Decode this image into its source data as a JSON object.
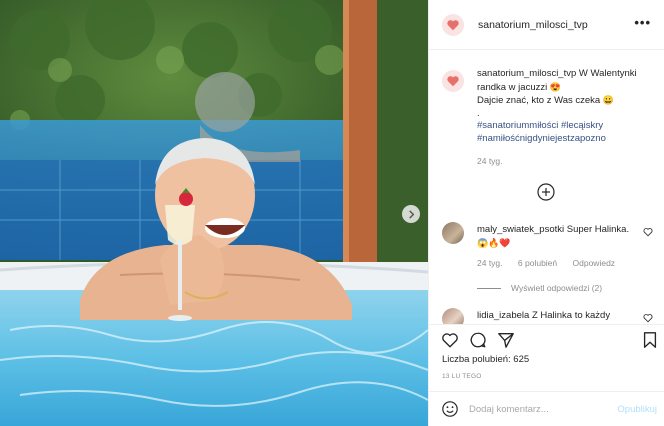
{
  "post": {
    "username": "sanatorium_milosci_tvp",
    "more_label": "•••"
  },
  "caption": {
    "username": "sanatorium_milosci_tvp",
    "text_1": "W Walentynki randka w jacuzzi",
    "emoji_1": "😍",
    "text_2": "Dajcie znać, kto z Was czeka",
    "emoji_2": "😀",
    "dot": ".",
    "hashtags": "#sanatoriummiłości #lecąiskry #namiłośćnigdyniejestzapozno",
    "time": "24 tyg."
  },
  "reply": {
    "username": "maly_swiatek_psotki",
    "text": "Super Halinka.",
    "emoji": "😱🔥❤️",
    "time": "24 tyg.",
    "likes": "6 polubień",
    "reply_label": "Odpowiedz",
    "view_replies": "Wyświetl odpowiedzi (2)"
  },
  "reply2": {
    "username": "lidia_izabela",
    "text": "Z Halinka to każdy"
  },
  "actions": {
    "likes_label": "Liczba polubień: 625",
    "date": "13 LU TEGO"
  },
  "composer": {
    "placeholder": "Dodaj komentarz...",
    "post_label": "Opublikuj"
  },
  "icons": {
    "avatar": "heart-avatar-icon",
    "more": "ellipsis-icon",
    "next": "chevron-right-icon",
    "load_more": "plus-circle-icon",
    "like": "heart-icon",
    "comment": "comment-icon",
    "share": "paper-plane-icon",
    "save": "bookmark-icon",
    "emoji": "smiley-icon"
  },
  "colors": {
    "link": "#385185",
    "muted": "#8e8e8e",
    "post_button_disabled": "#b2dffc",
    "avatar_heart": "#e8706a"
  }
}
